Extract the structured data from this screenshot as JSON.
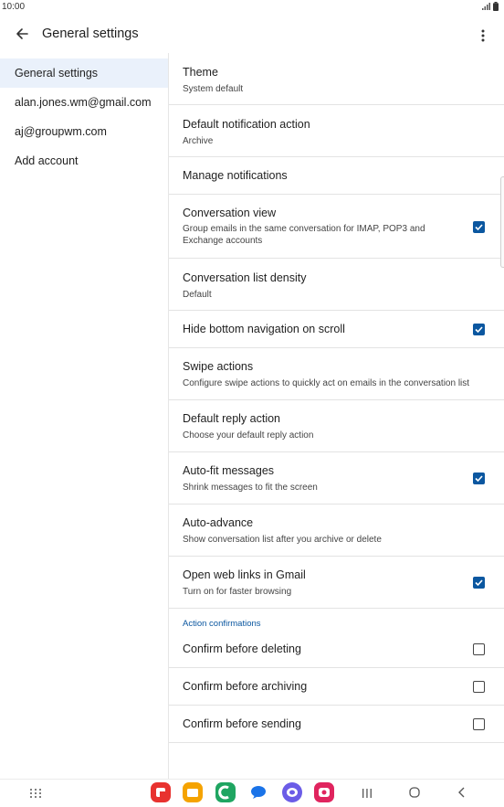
{
  "status": {
    "time": "10:00"
  },
  "appbar": {
    "title": "General settings"
  },
  "sidebar": {
    "items": [
      {
        "label": "General settings",
        "active": true
      },
      {
        "label": "alan.jones.wm@gmail.com"
      },
      {
        "label": "aj@groupwm.com"
      },
      {
        "label": "Add account"
      }
    ]
  },
  "settings": {
    "theme": {
      "title": "Theme",
      "sub": "System default"
    },
    "notif_action": {
      "title": "Default notification action",
      "sub": "Archive"
    },
    "manage_notif": {
      "title": "Manage notifications"
    },
    "conv_view": {
      "title": "Conversation view",
      "sub": "Group emails in the same conversation for IMAP, POP3 and Exchange accounts",
      "checked": true
    },
    "density": {
      "title": "Conversation list density",
      "sub": "Default"
    },
    "hide_nav": {
      "title": "Hide bottom navigation on scroll",
      "checked": true
    },
    "swipe": {
      "title": "Swipe actions",
      "sub": "Configure swipe actions to quickly act on emails in the conversation list"
    },
    "reply": {
      "title": "Default reply action",
      "sub": "Choose your default reply action"
    },
    "autofit": {
      "title": "Auto-fit messages",
      "sub": "Shrink messages to fit the screen",
      "checked": true
    },
    "autoadvance": {
      "title": "Auto-advance",
      "sub": "Show conversation list after you archive or delete"
    },
    "weblinks": {
      "title": "Open web links in Gmail",
      "sub": "Turn on for faster browsing",
      "checked": true
    },
    "section_header": "Action confirmations",
    "confirm_delete": {
      "title": "Confirm before deleting",
      "checked": false
    },
    "confirm_archive": {
      "title": "Confirm before archiving",
      "checked": false
    },
    "confirm_send": {
      "title": "Confirm before sending",
      "checked": false
    }
  },
  "colors": {
    "accent": "#0b57a0",
    "selected_bg": "#eaf1fb"
  },
  "navbar": {
    "icons": [
      "apps-grid-icon",
      "red-app-icon",
      "orange-folder-icon",
      "green-phone-icon",
      "blue-chat-icon",
      "purple-internet-icon",
      "pink-camera-icon",
      "recents-icon",
      "home-icon",
      "back-icon"
    ]
  }
}
